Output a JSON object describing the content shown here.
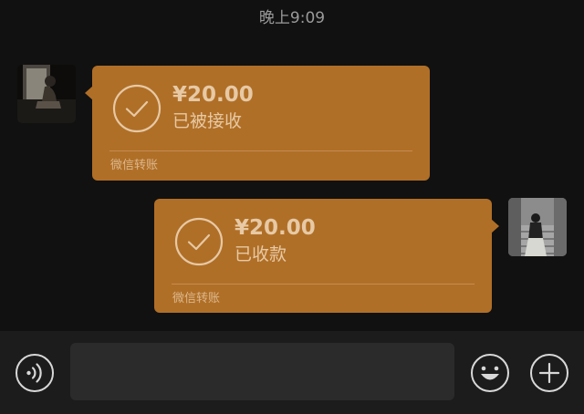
{
  "chat": {
    "timestamp": "晚上9:09",
    "messages": [
      {
        "direction": "incoming",
        "amount": "¥20.00",
        "status": "已被接收",
        "caption": "微信转账"
      },
      {
        "direction": "outgoing",
        "amount": "¥20.00",
        "status": "已收款",
        "caption": "微信转账"
      }
    ]
  },
  "input_bar": {
    "voice_icon": "voice-icon",
    "text_value": "",
    "emoji_icon": "emoji-icon",
    "more_icon": "plus-icon"
  },
  "colors": {
    "background": "#111111",
    "transfer_bubble": "#b06f27",
    "bubble_text": "#e7c9a5",
    "input_bar": "#1c1c1c",
    "input_field": "#2b2b2b"
  }
}
